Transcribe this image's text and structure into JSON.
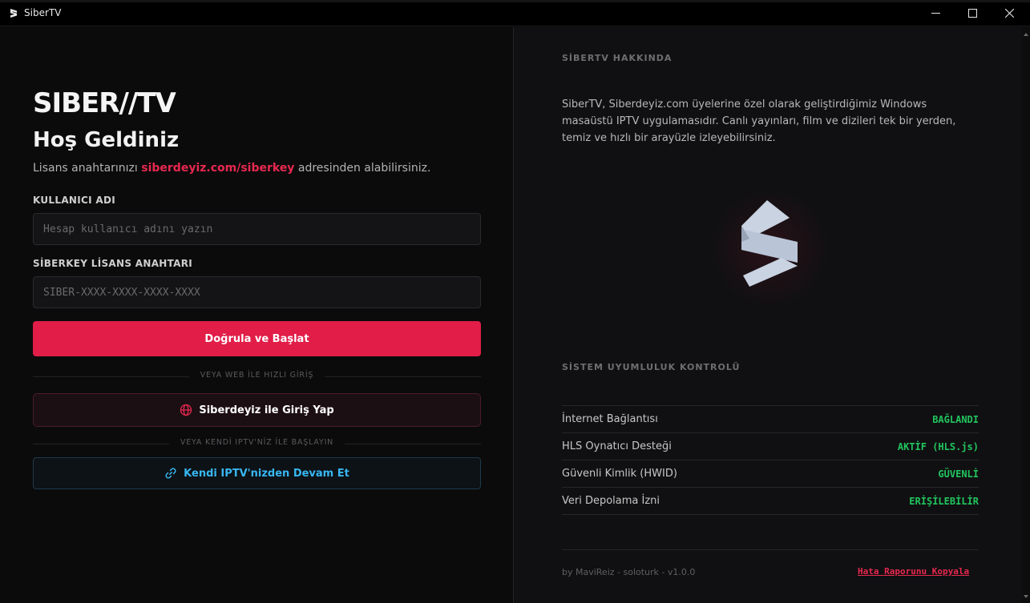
{
  "window": {
    "title": "SiberTV",
    "minimize": "—",
    "maximize": "☐",
    "close": "✕"
  },
  "login": {
    "brand": "SIBER//TV",
    "welcome": "Hoş Geldiniz",
    "sub_prefix": "Lisans anahtarınızı ",
    "sub_link": "siberdeyiz.com/siberkey",
    "sub_suffix": " adresinden alabilirsiniz.",
    "username_label": "KULLANICI ADI",
    "username_value": "",
    "username_placeholder": "Hesap kullanıcı adını yazın",
    "key_label": "SİBERKEY LİSANS ANAHTARI",
    "key_value": "",
    "key_placeholder": "SIBER-XXXX-XXXX-XXXX-XXXX",
    "submit_label": "Doğrula ve Başlat",
    "sep_web": "VEYA WEB İLE HIZLI GİRİŞ",
    "siberdeyiz_label": "Siberdeyiz ile Giriş Yap",
    "sep_iptv": "VEYA KENDİ IPTV'NİZ İLE BAŞLAYIN",
    "iptv_label": "Kendi IPTV'nizden Devam Et"
  },
  "about": {
    "title": "SİBERTV HAKKINDA",
    "text": "SiberTV, Siberdeyiz.com üyelerine özel olarak geliştirdiğimiz Windows masaüstü IPTV uygulamasıdır. Canlı yayınları, film ve dizileri tek bir yerden, temiz ve hızlı bir arayüzle izleyebilirsiniz."
  },
  "system": {
    "title": "SİSTEM UYUMLULUK KONTROLÜ",
    "checks": [
      {
        "label": "İnternet Bağlantısı",
        "status": "BAĞLANDI"
      },
      {
        "label": "HLS Oynatıcı Desteği",
        "status": "AKTİF (HLS.js)"
      },
      {
        "label": "Güvenli Kimlik (HWID)",
        "status": "GÜVENLİ"
      },
      {
        "label": "Veri Depolama İzni",
        "status": "ERİŞİLEBİLİR"
      }
    ]
  },
  "footer": {
    "credits": "by MaviReiz - soloturk - v1.0.0",
    "report_label": "Hata Raporunu Kopyala"
  },
  "colors": {
    "accent": "#e11d48",
    "link": "#38b6f0",
    "ok": "#22c55e",
    "background": "#0b0b0c"
  },
  "icons": {
    "app": "siber-s-logo-icon",
    "globe": "globe-icon",
    "link": "link-icon"
  }
}
